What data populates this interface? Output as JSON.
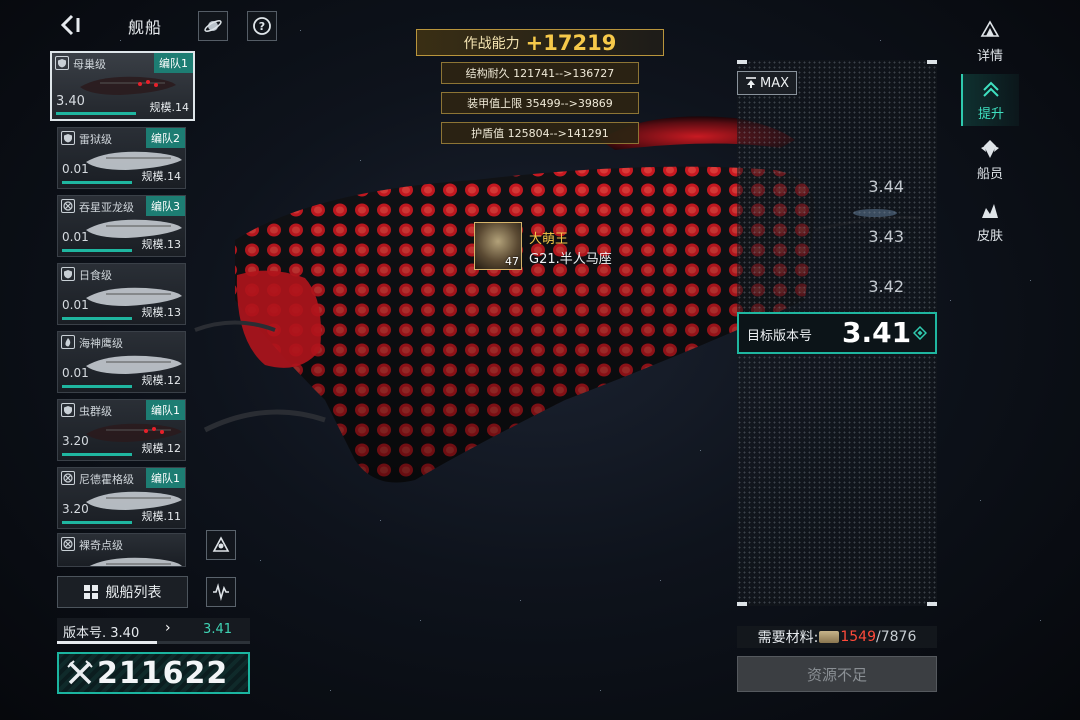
{
  "header": {
    "title": "舰船"
  },
  "ships": [
    {
      "name": "母巢级",
      "fleet": "编队1",
      "version": "3.40",
      "scale": "规模.14",
      "emblem": "shield"
    },
    {
      "name": "雷狱级",
      "fleet": "编队2",
      "version": "0.01",
      "scale": "规模.14",
      "emblem": "shield"
    },
    {
      "name": "吞星亚龙级",
      "fleet": "编队3",
      "version": "0.01",
      "scale": "规模.13",
      "emblem": "cross"
    },
    {
      "name": "日食级",
      "fleet": "",
      "version": "0.01",
      "scale": "规模.13",
      "emblem": "shield"
    },
    {
      "name": "海神鹰级",
      "fleet": "",
      "version": "0.01",
      "scale": "规模.12",
      "emblem": "flame"
    },
    {
      "name": "虫群级",
      "fleet": "编队1",
      "version": "3.20",
      "scale": "规模.12",
      "emblem": "shield"
    },
    {
      "name": "尼德霍格级",
      "fleet": "编队1",
      "version": "3.20",
      "scale": "规模.11",
      "emblem": "cross"
    },
    {
      "name": "裸奇点级",
      "fleet": "",
      "version": "",
      "scale": "",
      "emblem": "cross"
    }
  ],
  "ship_list_button": "舰船列表",
  "version_row": {
    "current": "版本号. 3.40",
    "next": "3.41"
  },
  "total_power": "211622",
  "combat": {
    "label": "作战能力",
    "value": "+17219"
  },
  "stat_changes": [
    "结构耐久 121741-->136727",
    "装甲值上限 35499-->39869",
    "护盾值 125804-->141291"
  ],
  "commander": {
    "name": "大萌王",
    "level": "47",
    "galaxy": "G21.半人马座"
  },
  "version_panel": {
    "max_label": "MAX",
    "options": [
      "3.44",
      "3.43",
      "3.42"
    ],
    "target_label": "目标版本号",
    "target_value": "3.41"
  },
  "materials": {
    "label": "需要材料:",
    "have": "1549",
    "need": "/7876"
  },
  "insufficient_button": "资源不足",
  "right_nav": [
    {
      "label": "详情",
      "icon": "details-icon",
      "active": false
    },
    {
      "label": "提升",
      "icon": "upgrade-icon",
      "active": true
    },
    {
      "label": "船员",
      "icon": "crew-icon",
      "active": false
    },
    {
      "label": "皮肤",
      "icon": "skin-icon",
      "active": false
    }
  ],
  "colors": {
    "accent_teal": "#1fb6a0",
    "gold": "#f6c94a",
    "warning_red": "#ff4a3a",
    "ship_glow": "#e8202a"
  }
}
